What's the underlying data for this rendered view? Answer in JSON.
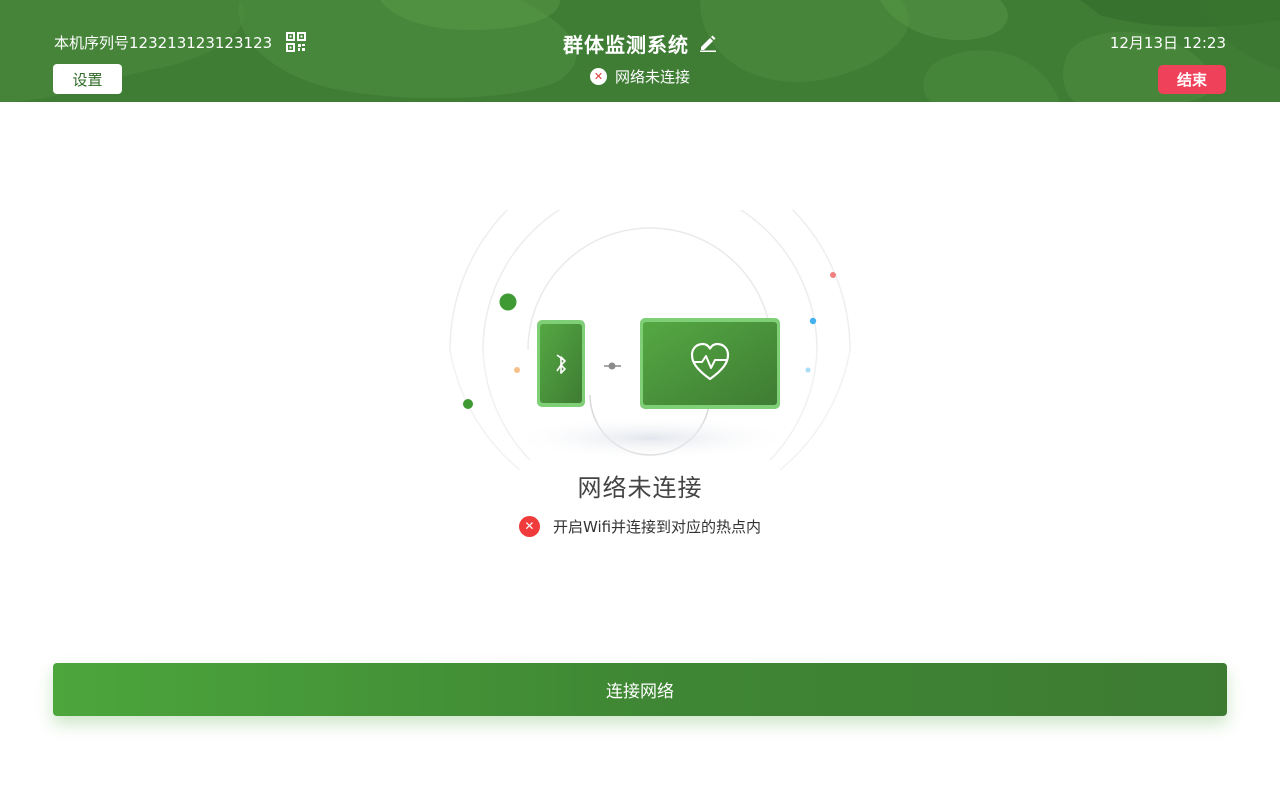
{
  "header": {
    "serial_label": "本机序列号123213123123123",
    "title": "群体监测系统",
    "network_status": "网络未连接",
    "datetime": "12月13日 12:23",
    "settings_label": "设置",
    "end_label": "结束"
  },
  "main": {
    "message": "网络未连接",
    "hint": "开启Wifi并连接到对应的热点内"
  },
  "actions": {
    "connect_label": "连接网络"
  },
  "icons": {
    "serial": "qr-code-icon",
    "title": "edit-pencil-icon",
    "status": "close-circle-icon",
    "phone": "bluetooth-icon",
    "monitor": "heart-pulse-icon",
    "link": "link-dots-icon"
  },
  "colors": {
    "header_green": "#3f7d35",
    "accent_green": "#4ca63c",
    "end_red": "#f0415a",
    "error_red": "#ef3b3b"
  }
}
